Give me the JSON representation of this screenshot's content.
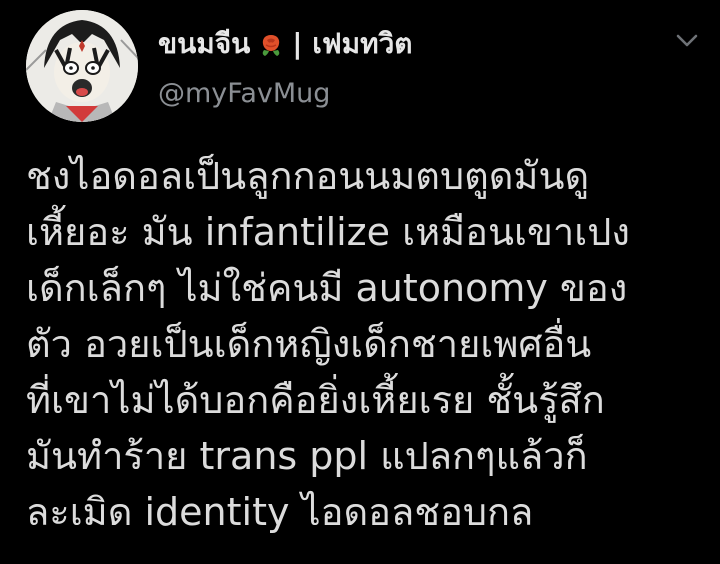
{
  "author": {
    "display_name": "ขนมจีน",
    "name_suffix": "| เฟมทวิต",
    "handle": "@myFavMug",
    "avatar_icon": "anime-character-avatar",
    "name_icon": "rose-icon"
  },
  "tweet": {
    "lines": [
      "ชงไอดอลเป็นลูกกอนนมตบตูดมันดู",
      "เหี้ยอะ มัน infantilize เหมือนเขาเปง",
      "เด็กเล็กๆ ไม่ใช่คนมี autonomy ของ",
      "ตัว อวยเป็นเด็กหญิงเด็กชายเพศอื่น",
      "ที่เขาไม่ได้บอกคือยิ่งเหี้ยเรย ชั้นรู้สึก",
      "มันทำร้าย trans ppl แปลกๆแล้วก็",
      "ละเมิด identity ไอดอลชอบกล"
    ]
  },
  "menu": {
    "icon": "chevron-down-icon"
  },
  "colors": {
    "background": "#000000",
    "name": "#e7e7e7",
    "handle": "#8b8f94",
    "text": "#dcdcdc",
    "rose": "#e0502a"
  }
}
